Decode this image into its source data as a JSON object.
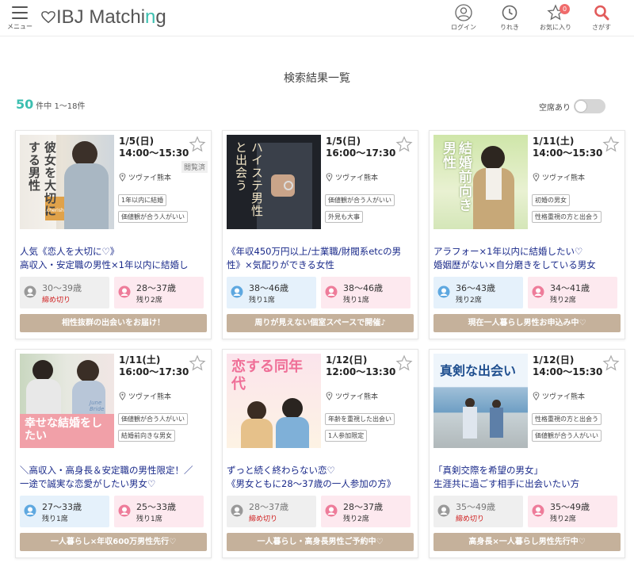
{
  "header": {
    "menu_label": "メニュー",
    "logo_main": "IBJ Matchi",
    "logo_accent": "n",
    "logo_end": "g",
    "icons": [
      {
        "name": "login",
        "label": "ログイン"
      },
      {
        "name": "history",
        "label": "りれき"
      },
      {
        "name": "favorite",
        "label": "お気に入り",
        "badge": "0"
      },
      {
        "name": "search",
        "label": "さがす"
      }
    ]
  },
  "page": {
    "title": "検索結果一覧",
    "count": "50",
    "count_suffix": "件中 1～18件",
    "vacancy_label": "空席あり"
  },
  "cards": [
    {
      "date": "1/5(日)",
      "time": "14:00～15:30",
      "venue": "ツヴァイ熊本",
      "viewed": "閲覧済",
      "tags": [
        "1年以内に結婚",
        "価値観が合う人がいい"
      ],
      "thumb_text": "彼女を大切にする男性",
      "thumb_sub": ".cherish",
      "title": "人気《恋人を大切に♡》\n高収入・安定職の男性×1年以内に結婚し",
      "male_age": "30～39歳",
      "male_seat": "締め切り",
      "male_closed": true,
      "female_age": "28～37歳",
      "female_seat": "残り2席",
      "female_closed": false,
      "banner": "相性抜群の出会いをお届け！"
    },
    {
      "date": "1/5(日)",
      "time": "16:00～17:30",
      "venue": "ツヴァイ熊本",
      "viewed": "",
      "tags": [
        "価値観が合う人がいい",
        "外見も大事"
      ],
      "thumb_text": "ハイステ男性と出会う",
      "thumb_sub": "",
      "title": "《年収450万円以上/士業職/財閥系etcの男\n性》×気配りができる女性",
      "male_age": "38～46歳",
      "male_seat": "残り1席",
      "male_closed": false,
      "female_age": "38～46歳",
      "female_seat": "残り1席",
      "female_closed": false,
      "banner": "周りが見えない個室スペースで開催♪"
    },
    {
      "date": "1/11(土)",
      "time": "14:00～15:30",
      "venue": "ツヴァイ熊本",
      "viewed": "",
      "tags": [
        "初婚の男女",
        "性格重視の方と出会う"
      ],
      "thumb_text": "結婚前向き男性",
      "thumb_sub": "",
      "title": "アラフォー×1年以内に結婚したい♡\n婚姻歴がない×自分磨きをしている男女",
      "male_age": "36～43歳",
      "male_seat": "残り2席",
      "male_closed": false,
      "female_age": "34～41歳",
      "female_seat": "残り2席",
      "female_closed": false,
      "banner": "現在一人暮らし男性お申込み中♡"
    },
    {
      "date": "1/11(土)",
      "time": "16:00～17:30",
      "venue": "ツヴァイ熊本",
      "viewed": "",
      "tags": [
        "価値観が合う人がいい",
        "結婚前向きな男女"
      ],
      "thumb_text": "幸せな結婚をしたい",
      "thumb_sub": "June Bride",
      "title": "＼高収入・高身長＆安定職の男性限定！／\n一途で誠実な恋愛がしたい男女♡",
      "male_age": "27～33歳",
      "male_seat": "残り1席",
      "male_closed": false,
      "female_age": "25～33歳",
      "female_seat": "残り1席",
      "female_closed": false,
      "banner": "一人暮らし×年収600万男性先行♡"
    },
    {
      "date": "1/12(日)",
      "time": "12:00～13:30",
      "venue": "ツヴァイ熊本",
      "viewed": "",
      "tags": [
        "年齢を重視した出会い",
        "1人参加限定"
      ],
      "thumb_text": "恋する同年代",
      "thumb_sub": "",
      "title": "ずっと続く終わらない恋♡\n《男女ともに28～37歳の一人参加の方》",
      "male_age": "28～37歳",
      "male_seat": "締め切り",
      "male_closed": true,
      "female_age": "28～37歳",
      "female_seat": "残り2席",
      "female_closed": false,
      "banner": "一人暮らし・高身長男性ご予約中♡"
    },
    {
      "date": "1/12(日)",
      "time": "14:00～15:30",
      "venue": "ツヴァイ熊本",
      "viewed": "",
      "tags": [
        "性格重視の方と出会う",
        "価値観が合う人がいい"
      ],
      "thumb_text": "真剣な出会い",
      "thumb_sub": "",
      "title": "「真剣交際を希望の男女」\n生涯共に過ごす相手に出会いたい方",
      "male_age": "35～49歳",
      "male_seat": "締め切り",
      "male_closed": true,
      "female_age": "35～49歳",
      "female_seat": "残り2席",
      "female_closed": false,
      "banner": "高身長×一人暮らし男性先行中♡"
    }
  ]
}
